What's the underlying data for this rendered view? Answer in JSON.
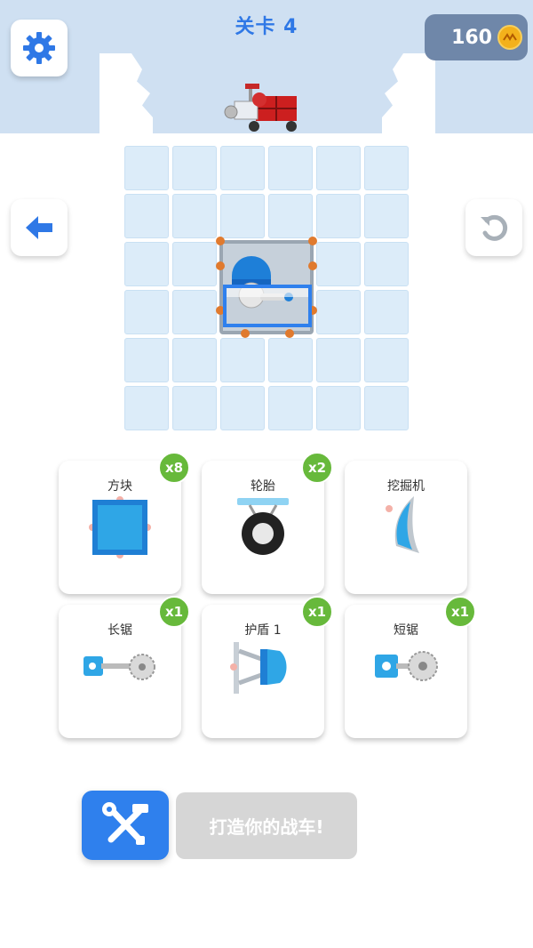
{
  "header": {
    "level_label": "关卡 4",
    "coins": "160"
  },
  "parts": [
    {
      "name": "方块",
      "count": "x8"
    },
    {
      "name": "轮胎",
      "count": "x2"
    },
    {
      "name": "挖掘机",
      "count": ""
    },
    {
      "name": "长锯",
      "count": "x1"
    },
    {
      "name": "护盾 1",
      "count": "x1"
    },
    {
      "name": "短锯",
      "count": "x1"
    }
  ],
  "footer": {
    "build_label": "打造你的战车!"
  },
  "colors": {
    "accent": "#2f78e6",
    "badge": "#67b93b"
  }
}
